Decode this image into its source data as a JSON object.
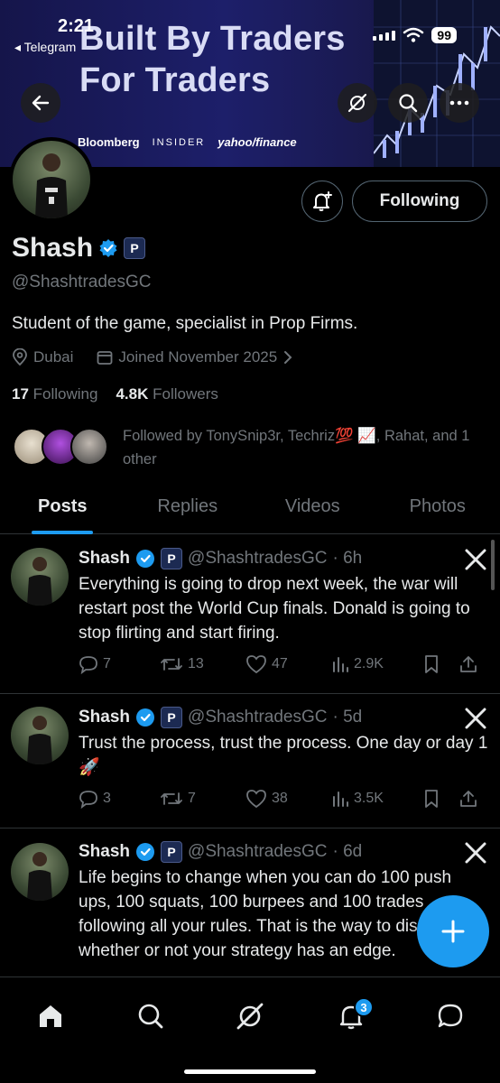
{
  "status_bar": {
    "time": "2:21",
    "back_app": "◂ Telegram",
    "battery": "99"
  },
  "banner": {
    "headline_1": "Built By Traders",
    "headline_2": "For Traders",
    "logos": [
      "Bloomberg",
      "INSIDER",
      "yahoo/finance"
    ]
  },
  "profile": {
    "name": "Shash",
    "badge_letter": "P",
    "handle": "@ShashtradesGC",
    "bio": "Student of the game, specialist in Prop Firms.",
    "location": "Dubai",
    "joined": "Joined November 2025",
    "following_count": "17",
    "following_label": "Following",
    "followers_count": "4.8K",
    "followers_label": "Followers",
    "followed_by": "Followed by TonySnip3r, Techriz💯 📈, Rahat, and 1 other",
    "follow_button": "Following"
  },
  "tabs": [
    "Posts",
    "Replies",
    "Videos",
    "Photos"
  ],
  "posts": [
    {
      "name": "Shash",
      "handle": "@ShashtradesGC",
      "time": "· 6h",
      "text": "Everything is going to drop next week, the war will restart post the World Cup finals. Donald is going to stop flirting and start firing.",
      "replies": "7",
      "reposts": "13",
      "likes": "47",
      "views": "2.9K"
    },
    {
      "name": "Shash",
      "handle": "@ShashtradesGC",
      "time": "· 5d",
      "text": "Trust the process, trust the process. One day or day 1 🚀",
      "replies": "3",
      "reposts": "7",
      "likes": "38",
      "views": "3.5K"
    },
    {
      "name": "Shash",
      "handle": "@ShashtradesGC",
      "time": "· 6d",
      "text": "Life begins to change when you can do 100 push ups, 100 squats, 100 burpees and 100 trades following all your rules. That is the way to discover whether or not your strategy has an edge.",
      "replies": "",
      "reposts": "",
      "likes": "",
      "views": ""
    }
  ],
  "nav": {
    "notification_count": "3"
  },
  "colors": {
    "accent": "#1d9bf0",
    "muted": "#71767b",
    "text": "#e7e9ea",
    "banner": "#1d1f6a"
  }
}
